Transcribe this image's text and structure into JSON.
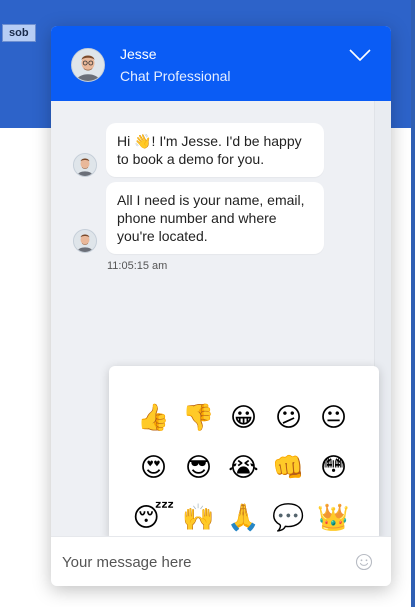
{
  "page": {
    "tag_label": "sob"
  },
  "header": {
    "agent_name": "Jesse",
    "agent_role": "Chat Professional",
    "collapse_icon": "chevron-down-icon",
    "background_color": "#0a5cf5"
  },
  "messages": [
    {
      "text": "Hi 👋! I'm Jesse. I'd be happy to book a demo for you."
    },
    {
      "text": "All I need is your name, email, phone number and where you're located."
    }
  ],
  "timestamp": "11:05:15 am",
  "emoji_picker": {
    "emojis": [
      "👍",
      "👎",
      "😀",
      "😕",
      "😐",
      "😍",
      "😎",
      "😭",
      "👊",
      "😳",
      "😴",
      "🙌",
      "🙏",
      "💬",
      "👑"
    ]
  },
  "composer": {
    "placeholder": "Your message here",
    "emoji_button_icon": "smiley-icon"
  }
}
